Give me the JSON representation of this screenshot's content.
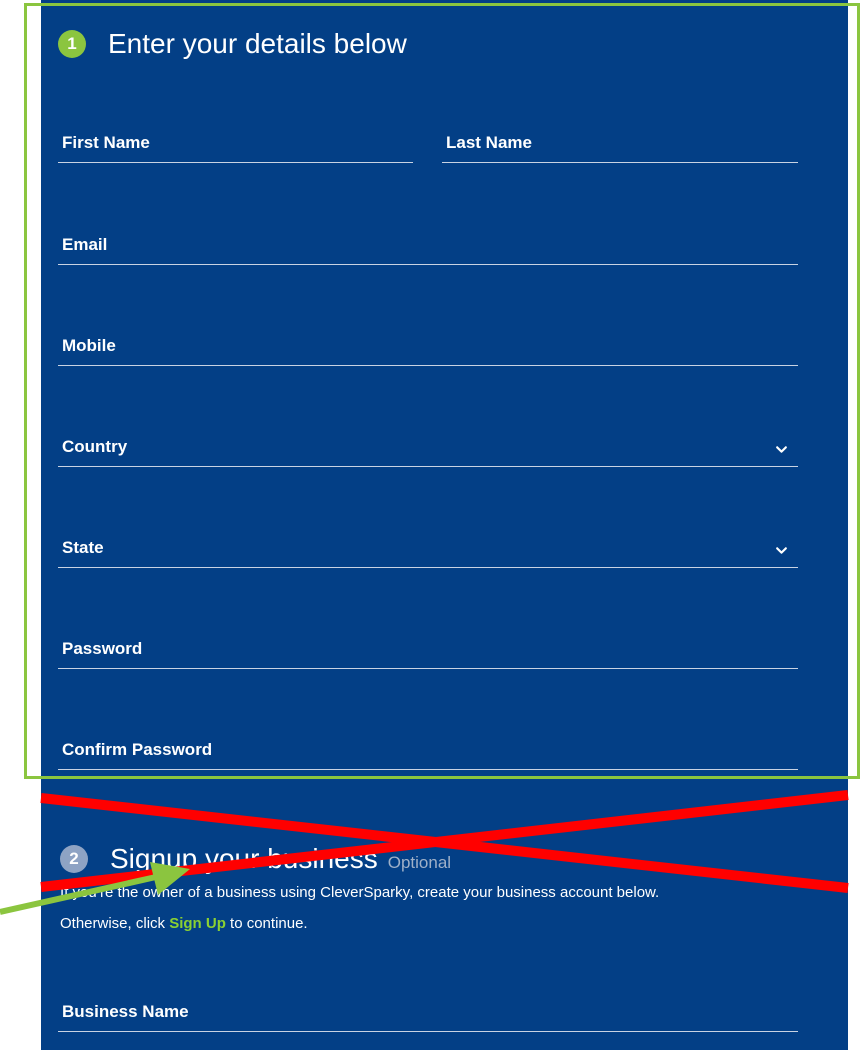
{
  "section1": {
    "step_number": "1",
    "title": "Enter your details below",
    "badge_color": "#8bc53f"
  },
  "fields": {
    "first_name": "First Name",
    "last_name": "Last Name",
    "email": "Email",
    "mobile": "Mobile",
    "country": "Country",
    "state": "State",
    "password": "Password",
    "confirm_password": "Confirm Password"
  },
  "section2": {
    "step_number": "2",
    "title": "Signup your business",
    "optional_label": "Optional",
    "intro_line1": "If you’re the owner of a business using CleverSparky, create your business account below.",
    "intro_line2_prefix": "Otherwise, click ",
    "intro_link": "Sign Up",
    "intro_line2_suffix": " to continue.",
    "business_name_label": "Business Name"
  },
  "colors": {
    "panel_background": "#033f86",
    "accent_green": "#8bc53f",
    "link_green": "#8bd132",
    "annotation_red": "#ff0000"
  },
  "icons": {
    "country_dropdown": "chevron-down-icon",
    "state_dropdown": "chevron-down-icon"
  }
}
